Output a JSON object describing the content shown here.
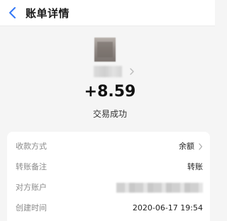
{
  "header": {
    "title": "账单详情",
    "back_icon": "chevron-left-icon"
  },
  "counterparty": {
    "avatar_icon": "user-avatar",
    "name_chevron_icon": "chevron-right-icon"
  },
  "transaction": {
    "amount": "+8.59",
    "status": "交易成功"
  },
  "details": {
    "rows": [
      {
        "label": "收款方式",
        "value": "余额"
      },
      {
        "label": "转账备注",
        "value": "转账"
      },
      {
        "label": "对方账户",
        "value": ""
      },
      {
        "label": "创建时间",
        "value": "2020-06-17 19:54"
      }
    ]
  },
  "colors": {
    "back_icon": "#3478f6",
    "background": "#f5f5f5",
    "card": "#ffffff",
    "label": "#8a8a8a"
  }
}
